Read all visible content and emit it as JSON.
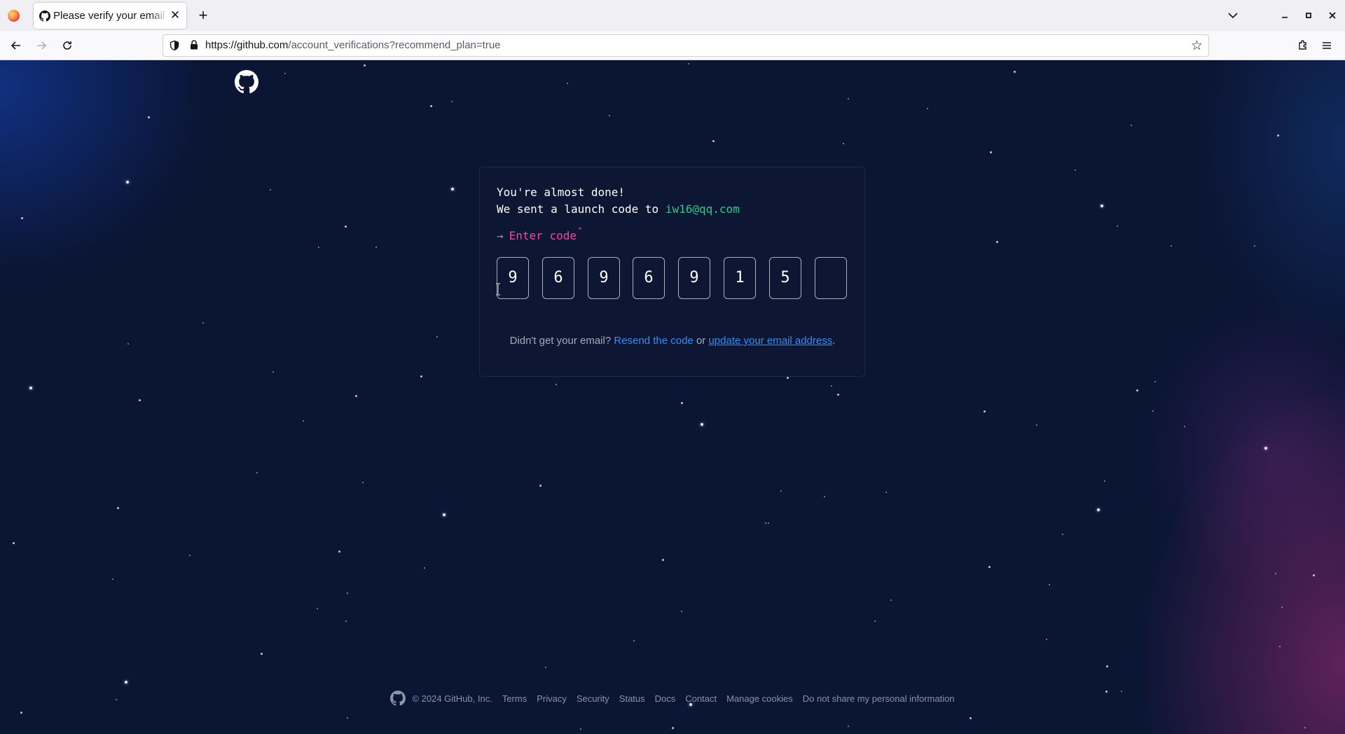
{
  "browser": {
    "tab_title": "Please verify your email a",
    "url_host": "https://github.com",
    "url_path": "/account_verifications?recommend_plan=true",
    "close_tab_label": "✕",
    "new_tab_label": "+"
  },
  "card": {
    "line1": "You're almost done!",
    "line2_prefix": "We sent a launch code to ",
    "email": "iw16@qq.com",
    "arrow": "→",
    "enter_code_label": "Enter code",
    "required_mark": "*",
    "code_digits": [
      "9",
      "6",
      "9",
      "6",
      "9",
      "1",
      "5",
      ""
    ]
  },
  "resend": {
    "prefix": "Didn't get your email? ",
    "resend_link": "Resend the code",
    "middle": " or ",
    "update_link": "update your email address",
    "suffix": "."
  },
  "footer": {
    "copyright": "© 2024 GitHub, Inc.",
    "links": [
      "Terms",
      "Privacy",
      "Security",
      "Status",
      "Docs",
      "Contact",
      "Manage cookies",
      "Do not share my personal information"
    ]
  },
  "colors": {
    "background": "#0b1534",
    "email": "#2fc98b",
    "enter_code": "#ea4aaa",
    "link": "#3c8cf0"
  }
}
